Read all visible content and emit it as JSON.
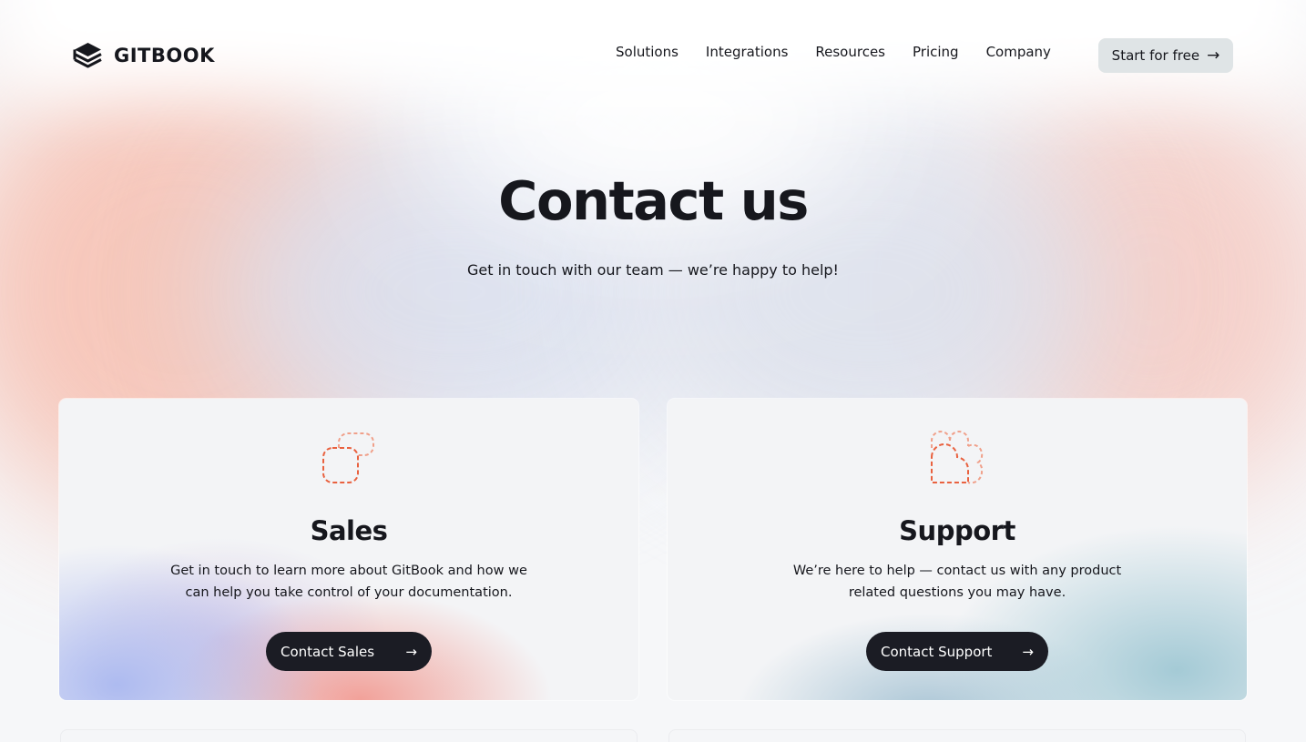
{
  "header": {
    "brand": "GITBOOK",
    "nav": [
      "Solutions",
      "Integrations",
      "Resources",
      "Pricing",
      "Company"
    ],
    "cta_label": "Start for free",
    "cta_icon": "arrow-right-icon"
  },
  "hero": {
    "title": "Contact us",
    "subtitle": "Get in touch with our team — we’re happy to help!"
  },
  "cards": [
    {
      "title": "Sales",
      "description": "Get in touch to learn more about GitBook and how we can help you take control of your documentation.",
      "button_label": "Contact Sales",
      "icon": "chat-bubbles-icon"
    },
    {
      "title": "Support",
      "description": "We’re here to help — contact us with any product related questions you may have.",
      "button_label": "Contact Support",
      "icon": "support-bubbles-icon"
    }
  ],
  "colors": {
    "accent": "#e9613f",
    "dark": "#1b1c24",
    "text": "#16171d"
  }
}
